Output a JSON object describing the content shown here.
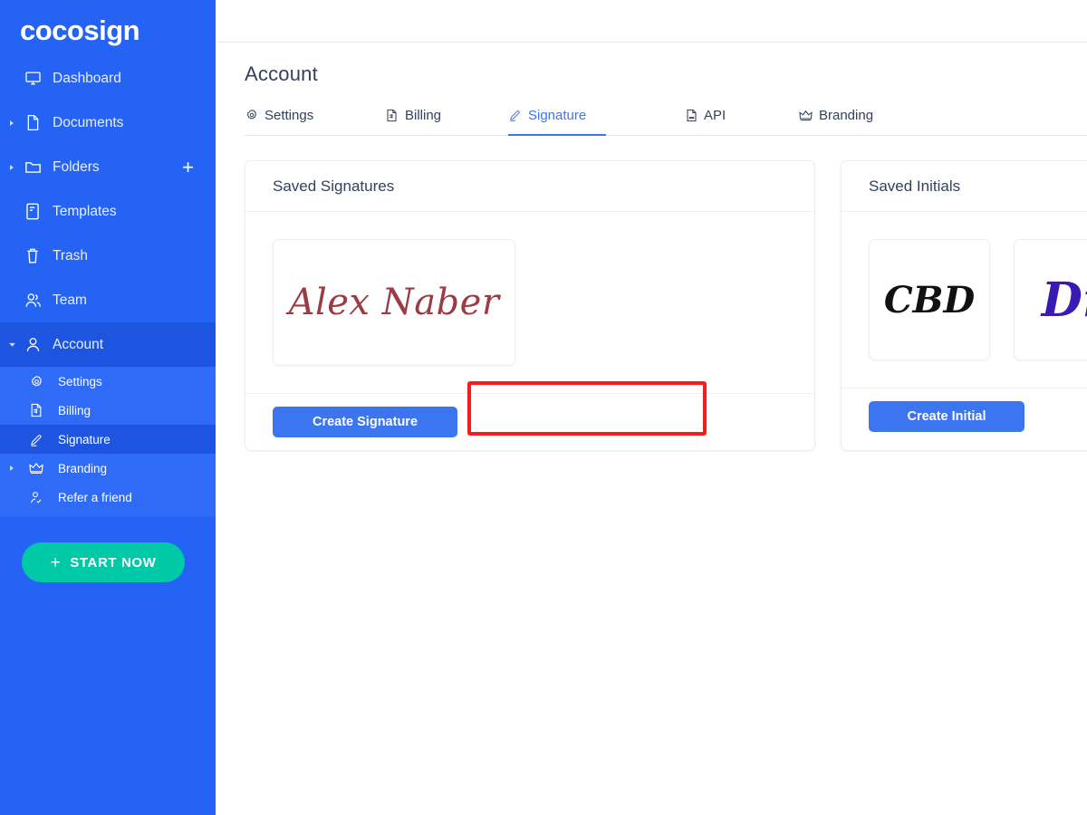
{
  "brand": {
    "name": "cocosign"
  },
  "sidebar": {
    "items": [
      {
        "label": "Dashboard",
        "icon": "monitor-icon",
        "caret": false,
        "active": false
      },
      {
        "label": "Documents",
        "icon": "document-icon",
        "caret": true,
        "active": false
      },
      {
        "label": "Folders",
        "icon": "folder-icon",
        "caret": true,
        "active": false,
        "action": "add-folder-icon"
      },
      {
        "label": "Templates",
        "icon": "template-icon",
        "caret": false,
        "active": false
      },
      {
        "label": "Trash",
        "icon": "trash-icon",
        "caret": false,
        "active": false
      },
      {
        "label": "Team",
        "icon": "team-icon",
        "caret": false,
        "active": false
      },
      {
        "label": "Account",
        "icon": "user-icon",
        "caret": true,
        "active": true
      }
    ],
    "submenu": [
      {
        "label": "Settings",
        "icon": "gear-icon",
        "caret": false,
        "active": false
      },
      {
        "label": "Billing",
        "icon": "invoice-icon",
        "caret": false,
        "active": false
      },
      {
        "label": "Signature",
        "icon": "pen-icon",
        "caret": false,
        "active": true
      },
      {
        "label": "Branding",
        "icon": "crown-icon",
        "caret": true,
        "active": false
      },
      {
        "label": "Refer a friend",
        "icon": "referral-icon",
        "caret": false,
        "active": false
      }
    ],
    "start_button": {
      "label": "START NOW",
      "icon": "plus-icon"
    }
  },
  "main": {
    "page_title": "Account",
    "tabs": [
      {
        "label": "Settings",
        "icon": "gear-icon",
        "active": false
      },
      {
        "label": "Billing",
        "icon": "invoice-icon",
        "active": false
      },
      {
        "label": "Signature",
        "icon": "pen-icon",
        "active": true
      },
      {
        "label": "API",
        "icon": "api-file-icon",
        "active": false
      },
      {
        "label": "Branding",
        "icon": "crown-icon",
        "active": false
      }
    ],
    "signatures_card": {
      "title": "Saved Signatures",
      "items": [
        {
          "text": "Alex Naber",
          "color": "#9b3b44"
        }
      ],
      "button_label": "Create Signature"
    },
    "initials_card": {
      "title": "Saved Initials",
      "items": [
        {
          "text": "CBD",
          "color": "#111111"
        },
        {
          "text": "Dr",
          "color": "#3b19b5"
        }
      ],
      "button_label": "Create Initial"
    }
  },
  "annotation": {
    "highlight_color": "#f41c1c",
    "target": "create-signature-button"
  },
  "colors": {
    "sidebar_blue": "#2563f5",
    "sidebar_active": "#1e55e0",
    "submenu_blue": "#2f6bf7",
    "accent_blue": "#3b75f0",
    "start_green": "#00c9a7",
    "title_navy": "#33415c"
  }
}
